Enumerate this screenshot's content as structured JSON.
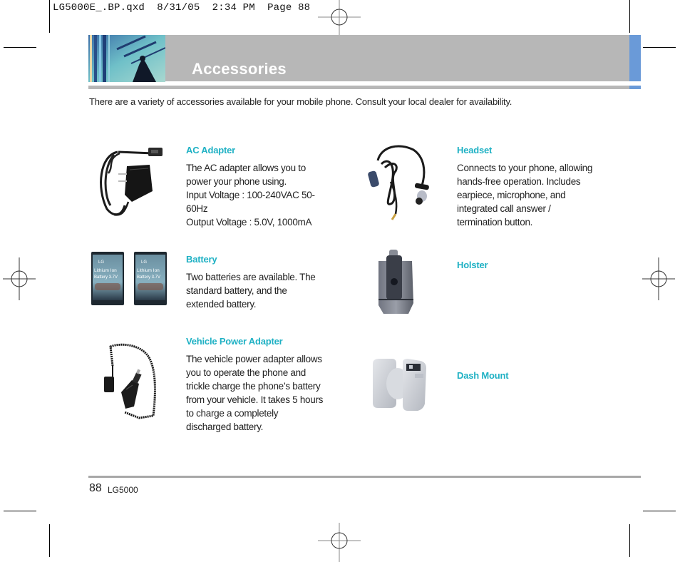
{
  "slug": {
    "filename": "LG5000E_.BP.qxd",
    "date": "8/31/05",
    "time": "2:34 PM",
    "page_label": "Page 88"
  },
  "header": {
    "title": "Accessories",
    "colors": {
      "bar": "#b7b7b7",
      "accent": "#6a9ad8",
      "heading": "#1fb1c4"
    }
  },
  "intro": "There are a variety of accessories available for your mobile phone. Consult your local dealer for availability.",
  "accessories": {
    "left": [
      {
        "title": "AC Adapter",
        "description": "The AC adapter allows you to\npower your phone using.\nInput Voltage : 100-240VAC 50-\n60Hz\nOutput Voltage : 5.0V, 1000mA",
        "image": "ac-adapter-photo"
      },
      {
        "title": "Battery",
        "description": "Two batteries are available. The\nstandard battery, and the\nextended battery.",
        "image": "battery-photo",
        "battery_label": {
          "brand": "LG",
          "line1": "Lithium Ion",
          "line2": "Battery 3.7V"
        }
      },
      {
        "title": "Vehicle Power Adapter",
        "description": "The vehicle power adapter allows\nyou to operate the phone and\ntrickle charge the phone’s battery\nfrom your vehicle. It takes 5 hours\nto charge a completely\ndischarged battery.",
        "image": "vehicle-adapter-photo"
      }
    ],
    "right": [
      {
        "title": "Headset",
        "description": "Connects to your phone, allowing\nhands-free operation. Includes\nearpiece, microphone, and\nintegrated call answer /\ntermination button.",
        "image": "headset-photo"
      },
      {
        "title": "Holster",
        "description": "",
        "image": "holster-photo"
      },
      {
        "title": "Dash Mount",
        "description": "",
        "image": "dash-mount-photo"
      }
    ]
  },
  "footer": {
    "page_number": "88",
    "model": "LG5000"
  }
}
